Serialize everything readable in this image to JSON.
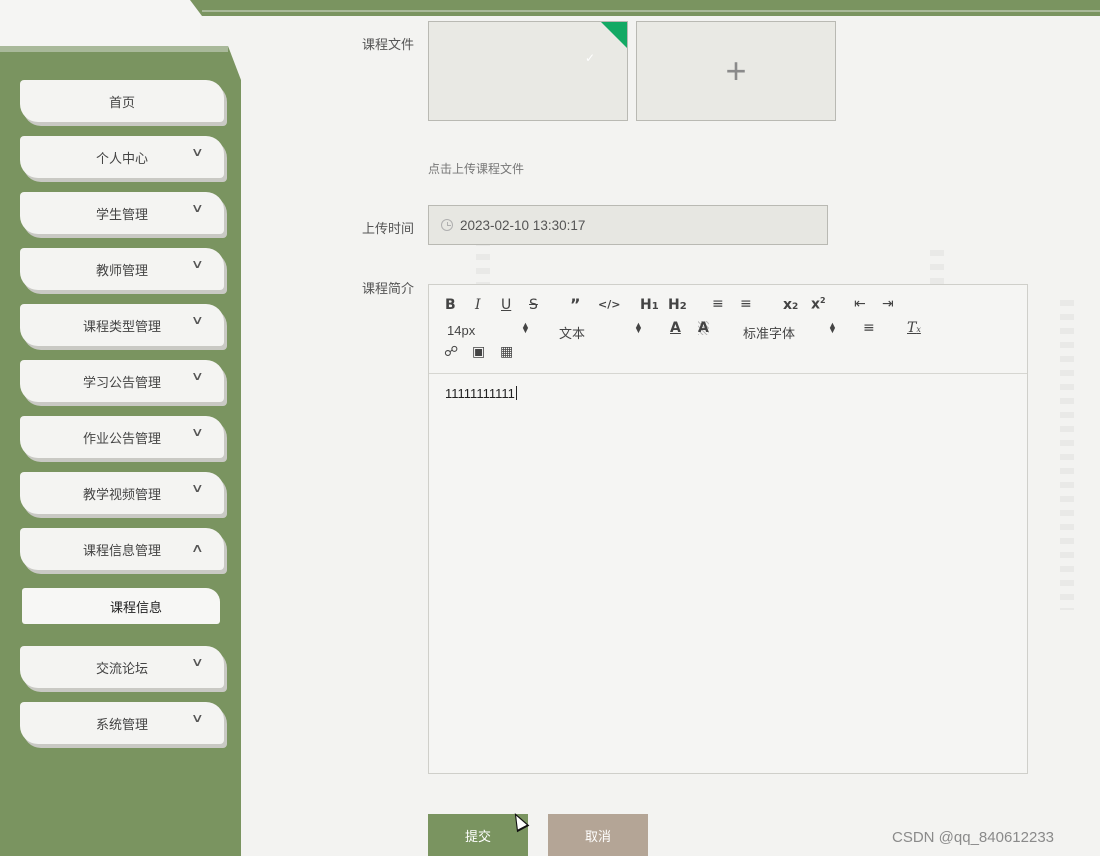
{
  "sidebar": {
    "items": [
      {
        "label": "首页",
        "chevron": ""
      },
      {
        "label": "个人中心",
        "chevron": "chevron-down"
      },
      {
        "label": "学生管理",
        "chevron": "chevron-down"
      },
      {
        "label": "教师管理",
        "chevron": "chevron-down"
      },
      {
        "label": "课程类型管理",
        "chevron": "chevron-down"
      },
      {
        "label": "学习公告管理",
        "chevron": "chevron-down"
      },
      {
        "label": "作业公告管理",
        "chevron": "chevron-down"
      },
      {
        "label": "教学视频管理",
        "chevron": "chevron-down"
      },
      {
        "label": "课程信息管理",
        "chevron": "chevron-up"
      },
      {
        "label": "交流论坛",
        "chevron": "chevron-down"
      },
      {
        "label": "系统管理",
        "chevron": "chevron-down"
      }
    ],
    "active_sub_item": "课程信息"
  },
  "form": {
    "course_file_label": "课程文件",
    "upload_hint": "点击上传课程文件",
    "upload_time_label": "上传时间",
    "upload_time_value": "2023-02-10 13:30:17",
    "intro_label": "课程简介"
  },
  "editor": {
    "font_size": "14px",
    "header_format": "文本",
    "font_family": "标准字体",
    "content": "11111111111"
  },
  "buttons": {
    "submit": "提交",
    "cancel": "取消"
  },
  "watermark": "CSDN @qq_840612233",
  "colors": {
    "theme_green": "#7a9460",
    "cancel_taupe": "#b4a596",
    "upload_success": "#13a964"
  }
}
